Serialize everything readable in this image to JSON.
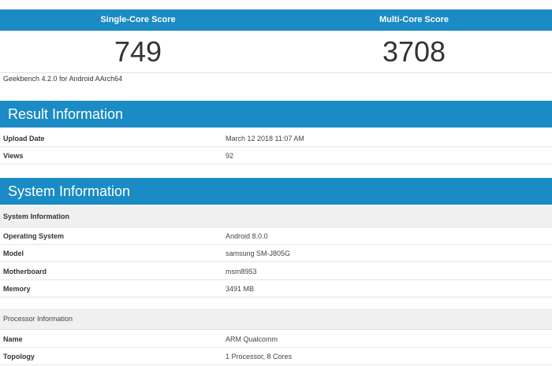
{
  "scores": {
    "single_label": "Single-Core Score",
    "multi_label": "Multi-Core Score",
    "single_value": "749",
    "multi_value": "3708"
  },
  "benchmark_version": "Geekbench 4.2.0 for Android AArch64",
  "result_info": {
    "title": "Result Information",
    "rows": [
      {
        "label": "Upload Date",
        "value": "March 12 2018 11:07 AM"
      },
      {
        "label": "Views",
        "value": "92"
      }
    ]
  },
  "system_info": {
    "title": "System Information",
    "subheader": "System Information",
    "rows": [
      {
        "label": "Operating System",
        "value": "Android 8.0.0"
      },
      {
        "label": "Model",
        "value": "samsung SM-J805G"
      },
      {
        "label": "Motherboard",
        "value": "msm8953"
      },
      {
        "label": "Memory",
        "value": "3491 MB"
      }
    ],
    "processor_subheader": "Processor Information",
    "processor_rows": [
      {
        "label": "Name",
        "value": "ARM Qualcomm"
      },
      {
        "label": "Topology",
        "value": "1 Processor, 8 Cores"
      }
    ]
  },
  "colors": {
    "accent": "#1a8bc4",
    "subheader_bg": "#f0f0f0"
  }
}
